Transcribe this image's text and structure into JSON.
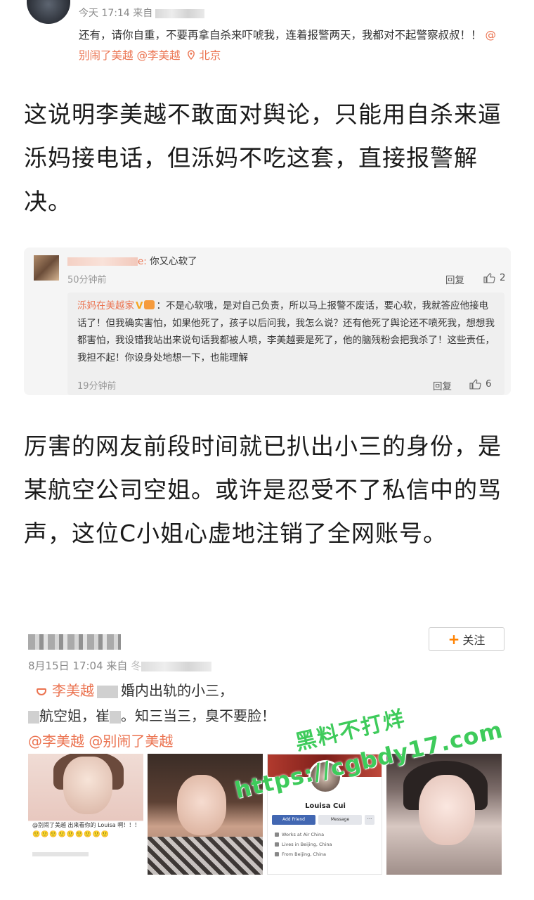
{
  "card1": {
    "time_prefix": "今天 17:14 来自",
    "body_text": "还有，请你自重，不要再拿自杀来吓唬我，连着报警两天，我都对不起警察叔叔！！",
    "mention1": "@别闹了美越",
    "mention2": "@李美越",
    "location": "北京"
  },
  "para1": "这说明李美越不敢面对舆论，只能用自杀来逼泺妈接电话，但泺妈不吃这套，直接报警解决。",
  "comment": {
    "name_suffix": "e:",
    "text": "你又心软了",
    "time": "50分钟前",
    "reply_label": "回复",
    "likes": "2",
    "sub": {
      "user": "泺妈在美越家",
      "text": "：不是心软哦，是对自己负责，所以马上报警不废话，要心软，我就答应他接电话了！但我确实害怕，如果他死了，孩子以后问我，我怎么说？还有他死了舆论还不喷死我，想想我都害怕，我设错我站出来说句话我都被人喷，李美越要是死了，他的脑残粉会把我杀了！这些责任，我担不起！你设身处地想一下，也能理解",
      "time": "19分钟前",
      "reply_label": "回复",
      "likes": "6"
    }
  },
  "para2": "厉害的网友前段时间就已扒出小三的身份，是某航空公司空姐。或许是忍受不了私信中的骂声，这位C小姐心虚地注销了全网账号。",
  "post": {
    "follow_label": "关注",
    "meta_prefix": "8月15日 17:04 来自",
    "meta_char": "冬",
    "tag_name": "李美越",
    "line1_rest": "婚内出轨的小三，",
    "line2_a": "航空姐，崔",
    "line2_b": "。知三当三，臭不要脸！",
    "mention1": "@李美越",
    "mention2": "@别闹了美越",
    "pic1_caption": "@别闹了美越 出来看你的 Louisa 啊！！！",
    "pic1_emojis": "🙂🙂🙂🙂🙂🙂🙂🙂🙂",
    "fb_name": "Louisa Cui",
    "fb_add": "Add Friend",
    "fb_msg": "Message",
    "fb_more": "···",
    "fb_info1": "Works at Air China",
    "fb_info2": "Lives in Beijing, China",
    "fb_info3": "From Beijing, China"
  },
  "watermark": {
    "line1": "黑料不打烊",
    "line2": "https://cgbdy17.com"
  },
  "colors": {
    "accent": "#eb7350",
    "watermark": "#3ecb5b",
    "follow_plus": "#ff8200"
  }
}
